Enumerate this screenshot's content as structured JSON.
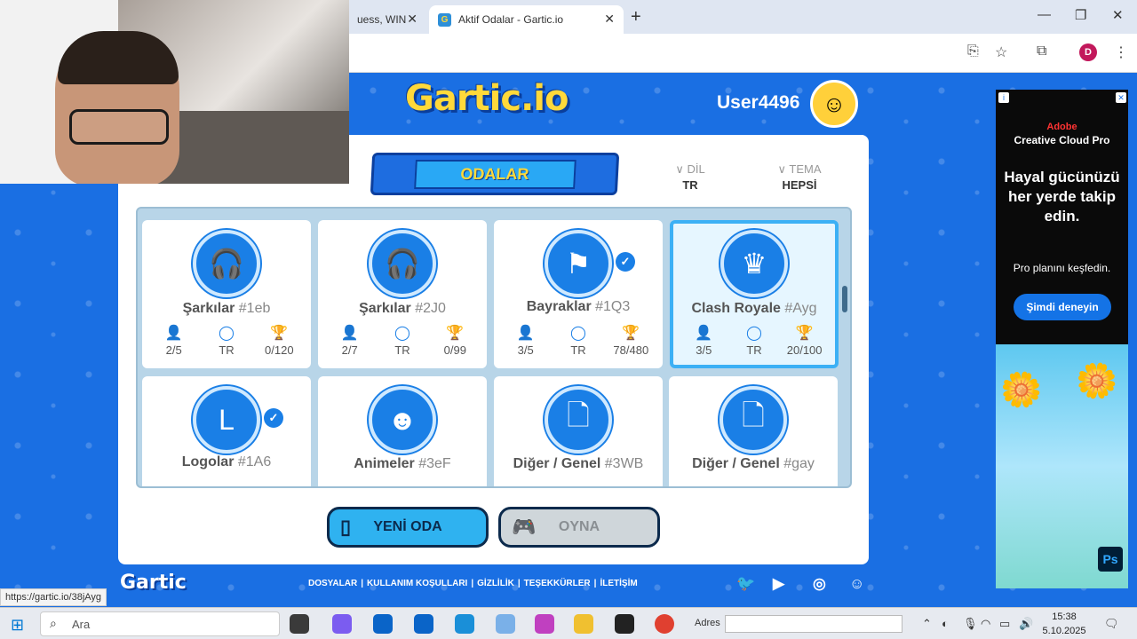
{
  "browser": {
    "tabs": [
      {
        "label": "uess, WIN"
      },
      {
        "label": "Aktif Odalar - Gartic.io",
        "favicon": "G"
      }
    ],
    "new_tab": "+",
    "profile_initial": "D"
  },
  "header": {
    "logo": "Gartic.io",
    "username": "User4496"
  },
  "rooms_panel": {
    "banner": "ODALAR",
    "filters": [
      {
        "label": "DİL",
        "value": "TR"
      },
      {
        "label": "TEMA",
        "value": "HEPSİ"
      }
    ],
    "rooms": [
      {
        "name": "Şarkılar",
        "code": "#1eb",
        "icon": "headphones-icon",
        "players": "2/5",
        "lang": "TR",
        "points": "0/120",
        "verified": false
      },
      {
        "name": "Şarkılar",
        "code": "#2J0",
        "icon": "headphones-icon",
        "players": "2/7",
        "lang": "TR",
        "points": "0/99",
        "verified": false
      },
      {
        "name": "Bayraklar",
        "code": "#1Q3",
        "icon": "flag-icon",
        "players": "3/5",
        "lang": "TR",
        "points": "78/480",
        "verified": true
      },
      {
        "name": "Clash Royale",
        "code": "#Ayg",
        "icon": "crown-icon",
        "players": "3/5",
        "lang": "TR",
        "points": "20/100",
        "verified": false
      },
      {
        "name": "Logolar",
        "code": "#1A6",
        "icon": "logo-icon",
        "verified": true
      },
      {
        "name": "Animeler",
        "code": "#3eF",
        "icon": "anime-face-icon",
        "verified": false
      },
      {
        "name": "Diğer / Genel",
        "code": "#3WB",
        "icon": "new-document-icon",
        "verified": false
      },
      {
        "name": "Diğer / Genel",
        "code": "#gay",
        "icon": "new-document-icon",
        "verified": false
      }
    ],
    "buttons": {
      "new_room": "YENİ ODA",
      "play": "OYNA"
    }
  },
  "footer": {
    "logo": "Gartic",
    "links": [
      "DOSYALAR",
      "KULLANIM KOŞULLARI",
      "GİZLİLİK",
      "TEŞEKKÜRLER",
      "İLETİŞİM"
    ]
  },
  "ad": {
    "brand": "Adobe",
    "product": "Creative Cloud Pro",
    "headline": "Hayal gücünüzü her yerde takip edin.",
    "sub": "Pro planını keşfedin.",
    "cta": "Şimdi deneyin",
    "app_badge": "Ps"
  },
  "status_bar": "https://gartic.io/38jAyg",
  "taskbar": {
    "search_placeholder": "Ara",
    "address_label": "Adres",
    "time": "15:38",
    "date": "5.10.2025"
  },
  "colors": {
    "page_bg": "#1a6fe3",
    "accent_yellow": "#ffd93a",
    "active_border": "#3cb0f5"
  }
}
